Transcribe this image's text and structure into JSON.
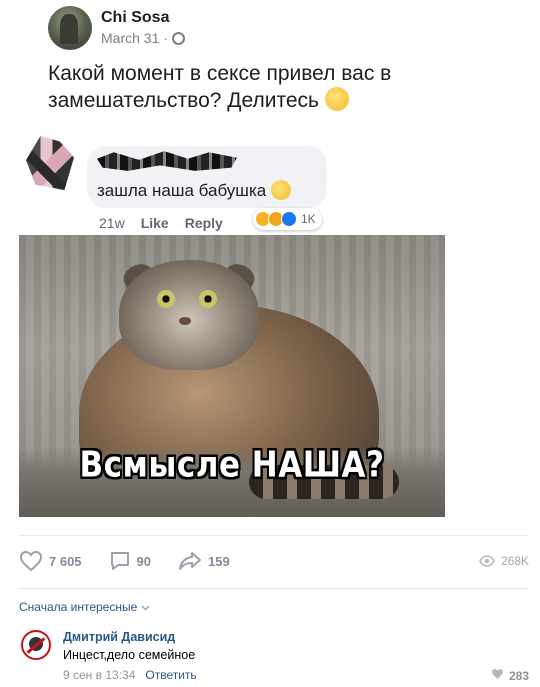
{
  "fb": {
    "author": "Chi Sosa",
    "date": "March 31 ·",
    "post_text": "Какой момент в сексе привел вас в замешательство? Делитесь",
    "comment": {
      "text": "зашла наша бабушка",
      "time": "21w",
      "like_label": "Like",
      "reply_label": "Reply",
      "reaction_count": "1K"
    },
    "meme_caption": "Всмысле НАША?"
  },
  "vk": {
    "likes": "7 605",
    "comments": "90",
    "shares": "159",
    "views": "268K",
    "sort_label": "Сначала интересные",
    "comment": {
      "author": "Дмитрий Дависид",
      "text": "Инцест,дело семейное",
      "timestamp": "9 сен в 13:34",
      "reply_label": "Ответить",
      "likes": "283"
    }
  },
  "colors": {
    "vk_link": "#2a5885",
    "vk_muted": "#828a99",
    "fb_text": "#1c1e21"
  }
}
